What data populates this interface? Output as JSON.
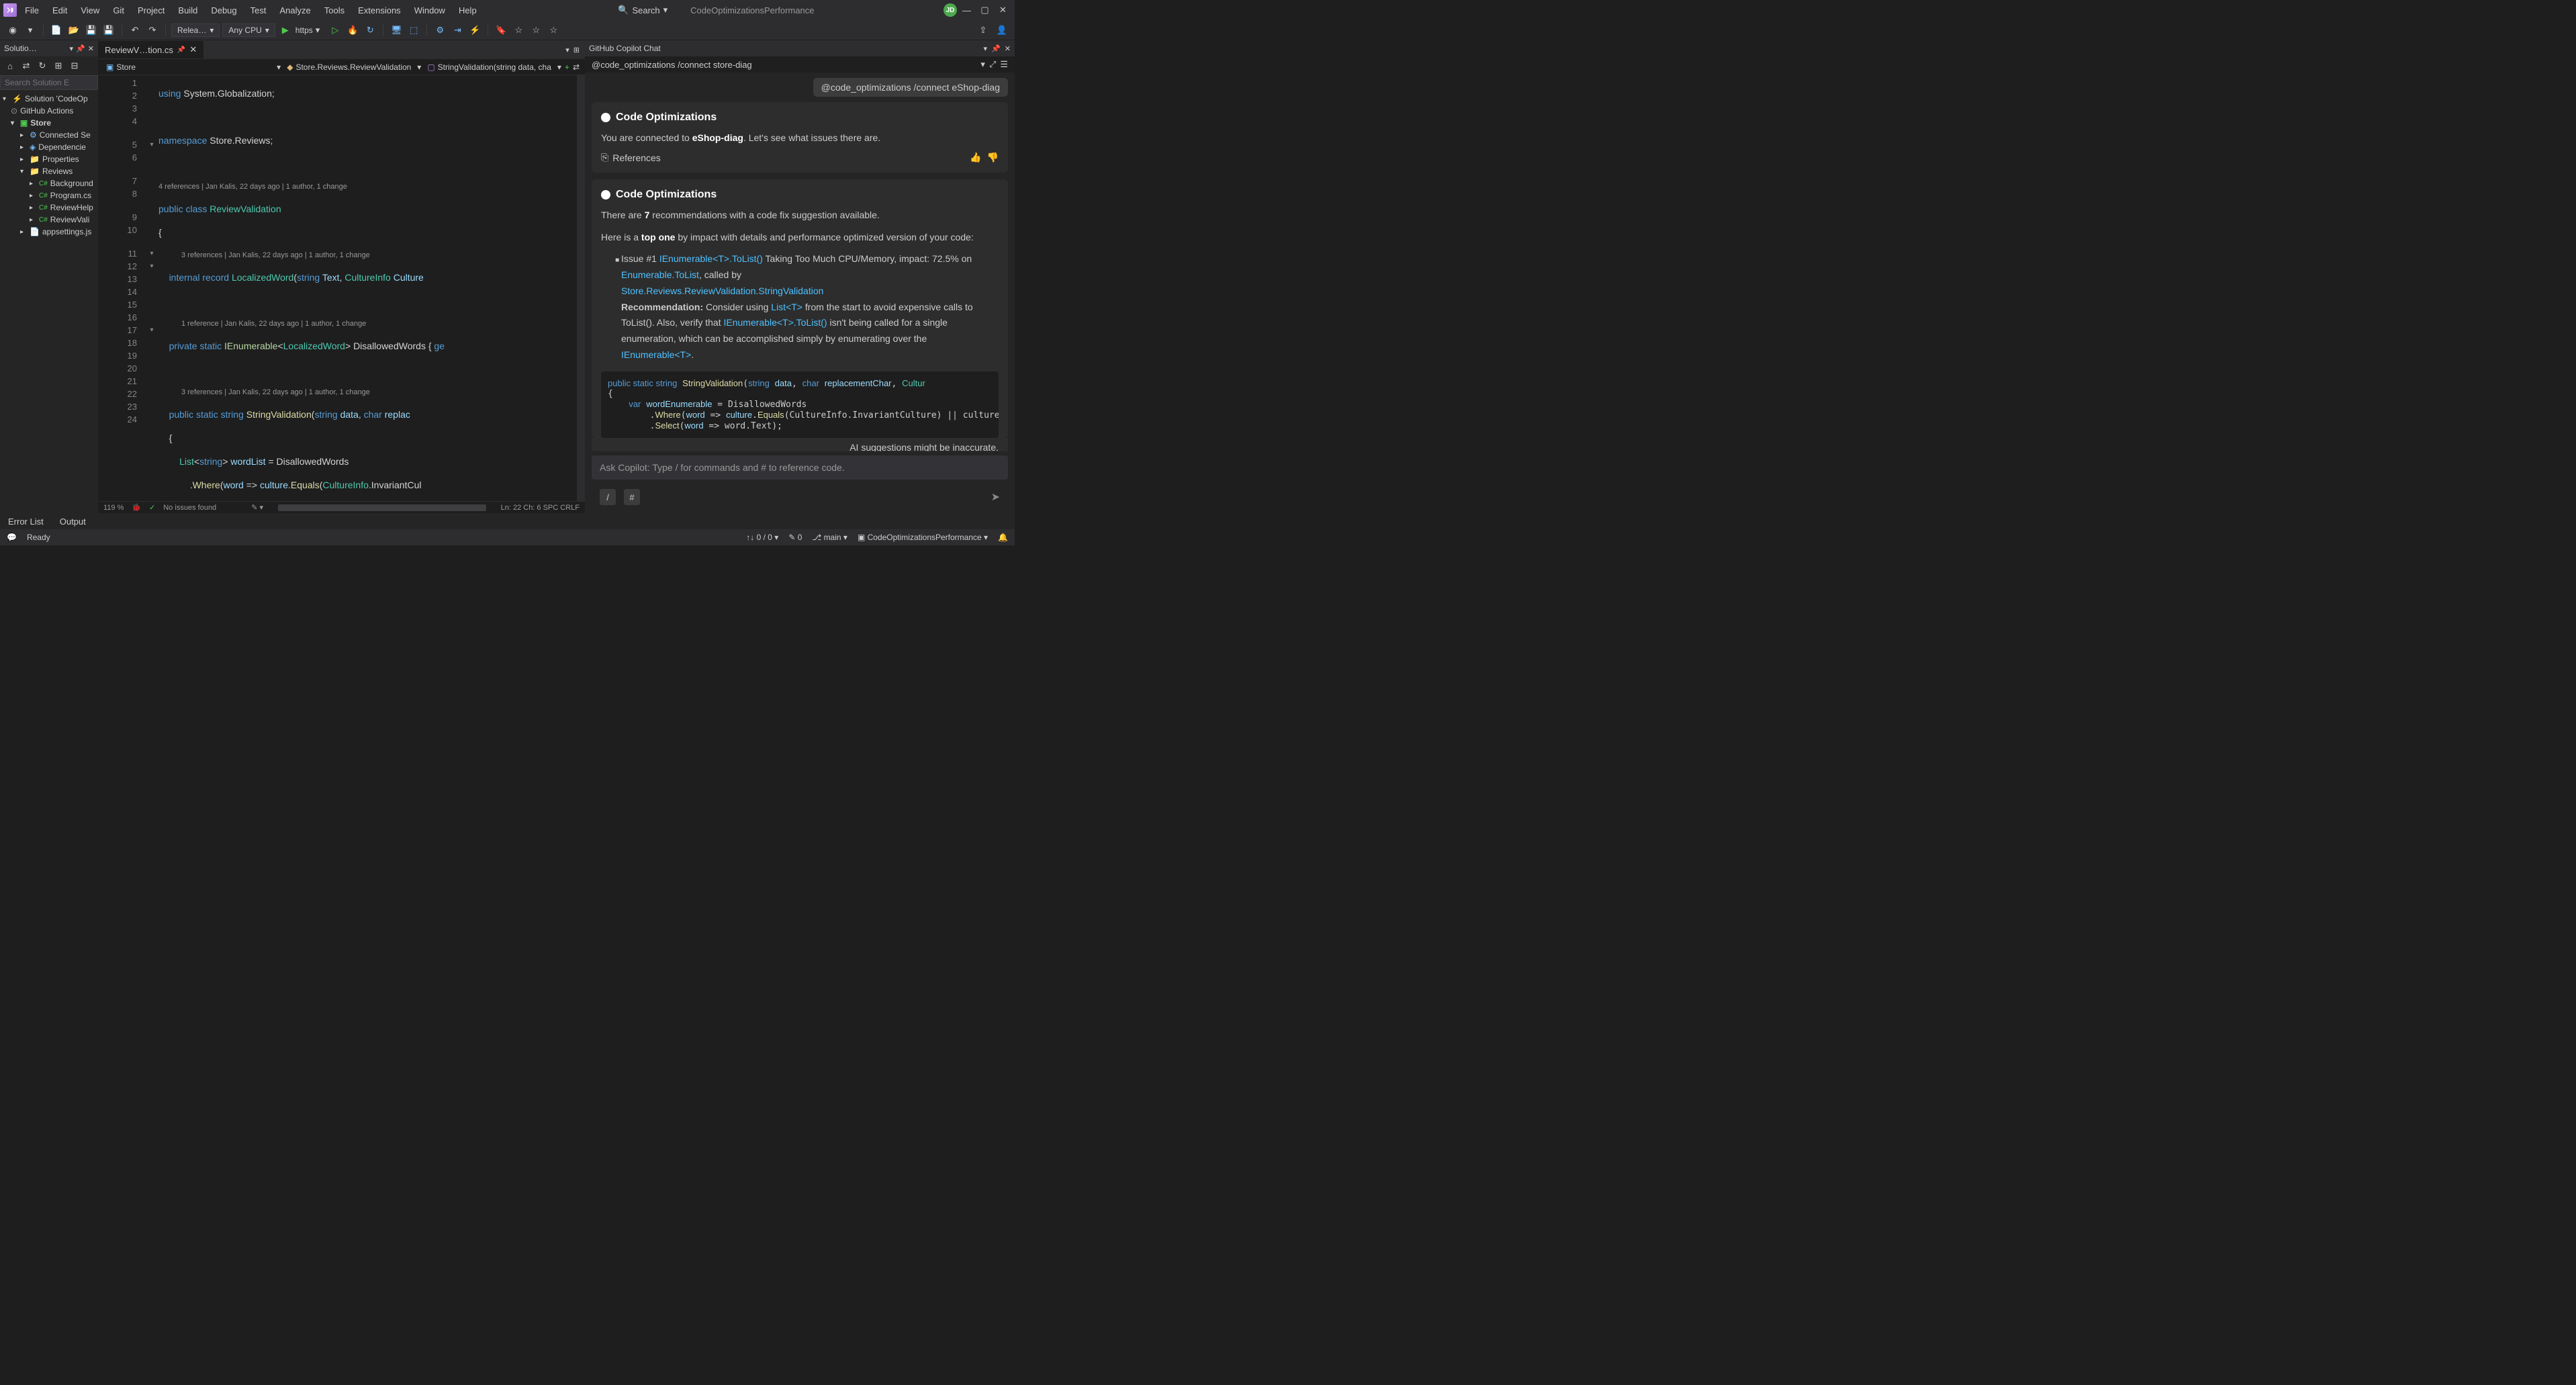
{
  "title": "CodeOptimizationsPerformance",
  "menu": [
    "File",
    "Edit",
    "View",
    "Git",
    "Project",
    "Build",
    "Debug",
    "Test",
    "Analyze",
    "Tools",
    "Extensions",
    "Window",
    "Help"
  ],
  "search_label": "Search",
  "avatar": "JD",
  "toolbar": {
    "config": "Relea…",
    "platform": "Any CPU",
    "start": "https"
  },
  "solution": {
    "title": "Solutio…",
    "search_placeholder": "Search Solution E",
    "root": "Solution 'CodeOp",
    "actions": "GitHub Actions",
    "project": "Store",
    "items": [
      "Connected Se",
      "Dependencie",
      "Properties",
      "Reviews"
    ],
    "reviews_children": [
      "Background",
      "Program.cs",
      "ReviewHelp",
      "ReviewVali"
    ],
    "appsettings": "appsettings.js"
  },
  "editor": {
    "tab": "ReviewV…tion.cs",
    "breadcrumb": {
      "a": "Store",
      "b": "Store.Reviews.ReviewValidation",
      "c": "StringValidation(string data, cha"
    },
    "zoom": "119 %",
    "no_issues": "No issues found",
    "pos": "Ln: 22   Ch: 6   SPC   CRLF",
    "codelens": {
      "class": "4 references | Jan Kalis, 22 days ago | 1 author, 1 change",
      "record": "3 references | Jan Kalis, 22 days ago | 1 author, 1 change",
      "private": "1 reference | Jan Kalis, 22 days ago | 1 author, 1 change",
      "method": "3 references | Jan Kalis, 22 days ago | 1 author, 1 change"
    }
  },
  "copilot": {
    "title": "GitHub Copilot Chat",
    "prompt1": "@code_optimizations /connect store-diag",
    "chip": "@code_optimizations /connect eShop-diag",
    "header": "Code Optimizations",
    "connected_pre": "You are connected to ",
    "connected_target": "eShop-diag",
    "connected_post": ". Let's see what issues there are.",
    "references": "References",
    "recs_pre": "There are ",
    "recs_count": "7",
    "recs_post": " recommendations with a code fix suggestion available.",
    "topone_pre": "Here is a ",
    "topone_bold": "top one",
    "topone_post": " by impact with details and performance optimized version of your code:",
    "issue_num": "Issue #1 ",
    "issue_link1": "IEnumerable<T>.ToList()",
    "issue_text1": " Taking Too Much CPU/Memory, impact: 72.5% on ",
    "issue_link2": "Enumerable.ToList",
    "issue_text2": ", called by ",
    "issue_link3": "Store.Reviews.ReviewValidation.StringValidation",
    "rec_label": "Recommendation:",
    "rec_text1": " Consider using ",
    "rec_link1": "List<T>",
    "rec_text2": " from the start to avoid expensive calls to ToList(). Also, verify that ",
    "rec_link2": "IEnumerable<T>.ToList()",
    "rec_text3": " isn't being called for a single enumeration, which can be accomplished simply by enumerating over the ",
    "rec_link3": "IEnumerable<T>",
    "disclaimer": "AI suggestions might be inaccurate.",
    "input_placeholder": "Ask Copilot: Type / for commands and # to reference code."
  },
  "bottom_tabs": [
    "Error List",
    "Output"
  ],
  "status": {
    "ready": "Ready",
    "up_down": "0 / 0",
    "changes": "0",
    "branch": "main",
    "project": "CodeOptimizationsPerformance"
  }
}
